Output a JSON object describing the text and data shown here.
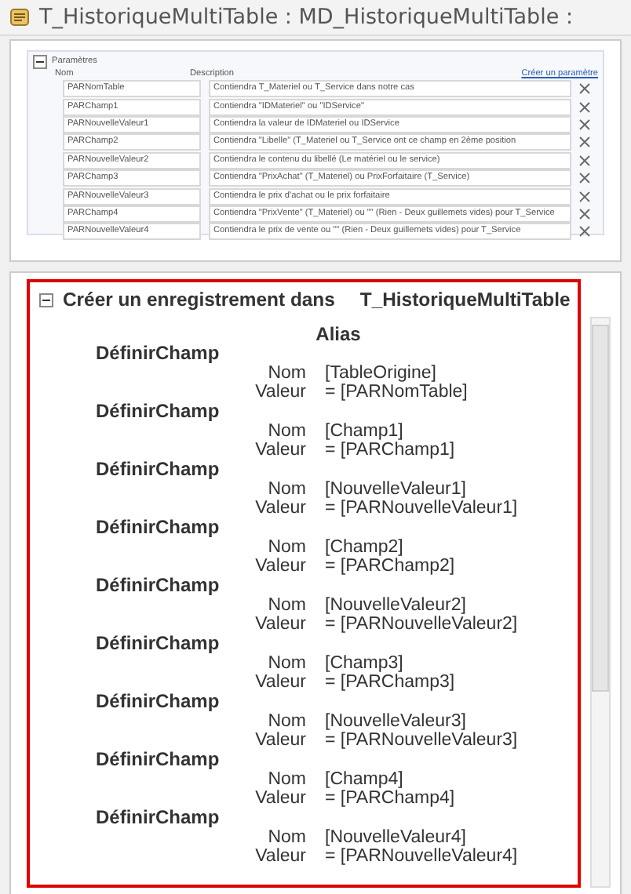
{
  "window": {
    "title": "T_HistoriqueMultiTable : MD_HistoriqueMultiTable :"
  },
  "parameters": {
    "title": "Paramètres",
    "expanded": true,
    "columns": [
      "Nom",
      "Description"
    ],
    "create_link": "Créer un paramètre",
    "rows": [
      {
        "name": "PARNomTable",
        "description": "Contiendra T_Materiel ou T_Service dans notre cas"
      },
      {
        "name": "PARChamp1",
        "description": "Contiendra \"IDMateriel\" ou \"IDService\""
      },
      {
        "name": "PARNouvelleValeur1",
        "description": "Contiendra la valeur de IDMateriel ou IDService"
      },
      {
        "name": "PARChamp2",
        "description": "Contiendra \"Libelle\" (T_Materiel ou T_Service ont ce champ en 2ème position"
      },
      {
        "name": "PARNouvelleValeur2",
        "description": "Contiendra le contenu du libellé (Le matériel ou le service)"
      },
      {
        "name": "PARChamp3",
        "description": "Contiendra \"PrixAchat\" (T_Materiel) ou PrixForfaitaire (T_Service)"
      },
      {
        "name": "PARNouvelleValeur3",
        "description": "Contiendra le prix d'achat ou le prix forfaitaire"
      },
      {
        "name": "PARChamp4",
        "description": "Contiendra \"PrixVente\" (T_Materiel) ou \"\" (Rien  - Deux guillemets vides)  pour T_Service"
      },
      {
        "name": "PARNouvelleValeur4",
        "description": "Contiendra le prix de vente ou \"\"  (Rien  - Deux guillemets vides)  pour T_Service"
      }
    ]
  },
  "macro": {
    "expanded": true,
    "action": "Créer un enregistrement dans",
    "table": "T_HistoriqueMultiTable",
    "alias_label": "Alias",
    "actions": [
      {
        "action": "DéfinirChamp",
        "nom_label": "Nom",
        "nom": "[TableOrigine]",
        "valeur_label": "Valeur",
        "valeur": "= [PARNomTable]"
      },
      {
        "action": "DéfinirChamp",
        "nom_label": "Nom",
        "nom": "[Champ1]",
        "valeur_label": "Valeur",
        "valeur": "= [PARChamp1]"
      },
      {
        "action": "DéfinirChamp",
        "nom_label": "Nom",
        "nom": "[NouvelleValeur1]",
        "valeur_label": "Valeur",
        "valeur": "= [PARNouvelleValeur1]"
      },
      {
        "action": "DéfinirChamp",
        "nom_label": "Nom",
        "nom": "[Champ2]",
        "valeur_label": "Valeur",
        "valeur": "= [PARChamp2]"
      },
      {
        "action": "DéfinirChamp",
        "nom_label": "Nom",
        "nom": "[NouvelleValeur2]",
        "valeur_label": "Valeur",
        "valeur": "= [PARNouvelleValeur2]"
      },
      {
        "action": "DéfinirChamp",
        "nom_label": "Nom",
        "nom": "[Champ3]",
        "valeur_label": "Valeur",
        "valeur": "= [PARChamp3]"
      },
      {
        "action": "DéfinirChamp",
        "nom_label": "Nom",
        "nom": "[NouvelleValeur3]",
        "valeur_label": "Valeur",
        "valeur": "= [PARNouvelleValeur3]"
      },
      {
        "action": "DéfinirChamp",
        "nom_label": "Nom",
        "nom": "[Champ4]",
        "valeur_label": "Valeur",
        "valeur": "= [PARChamp4]"
      },
      {
        "action": "DéfinirChamp",
        "nom_label": "Nom",
        "nom": "[NouvelleValeur4]",
        "valeur_label": "Valeur",
        "valeur": "= [PARNouvelleValeur4]"
      }
    ]
  }
}
